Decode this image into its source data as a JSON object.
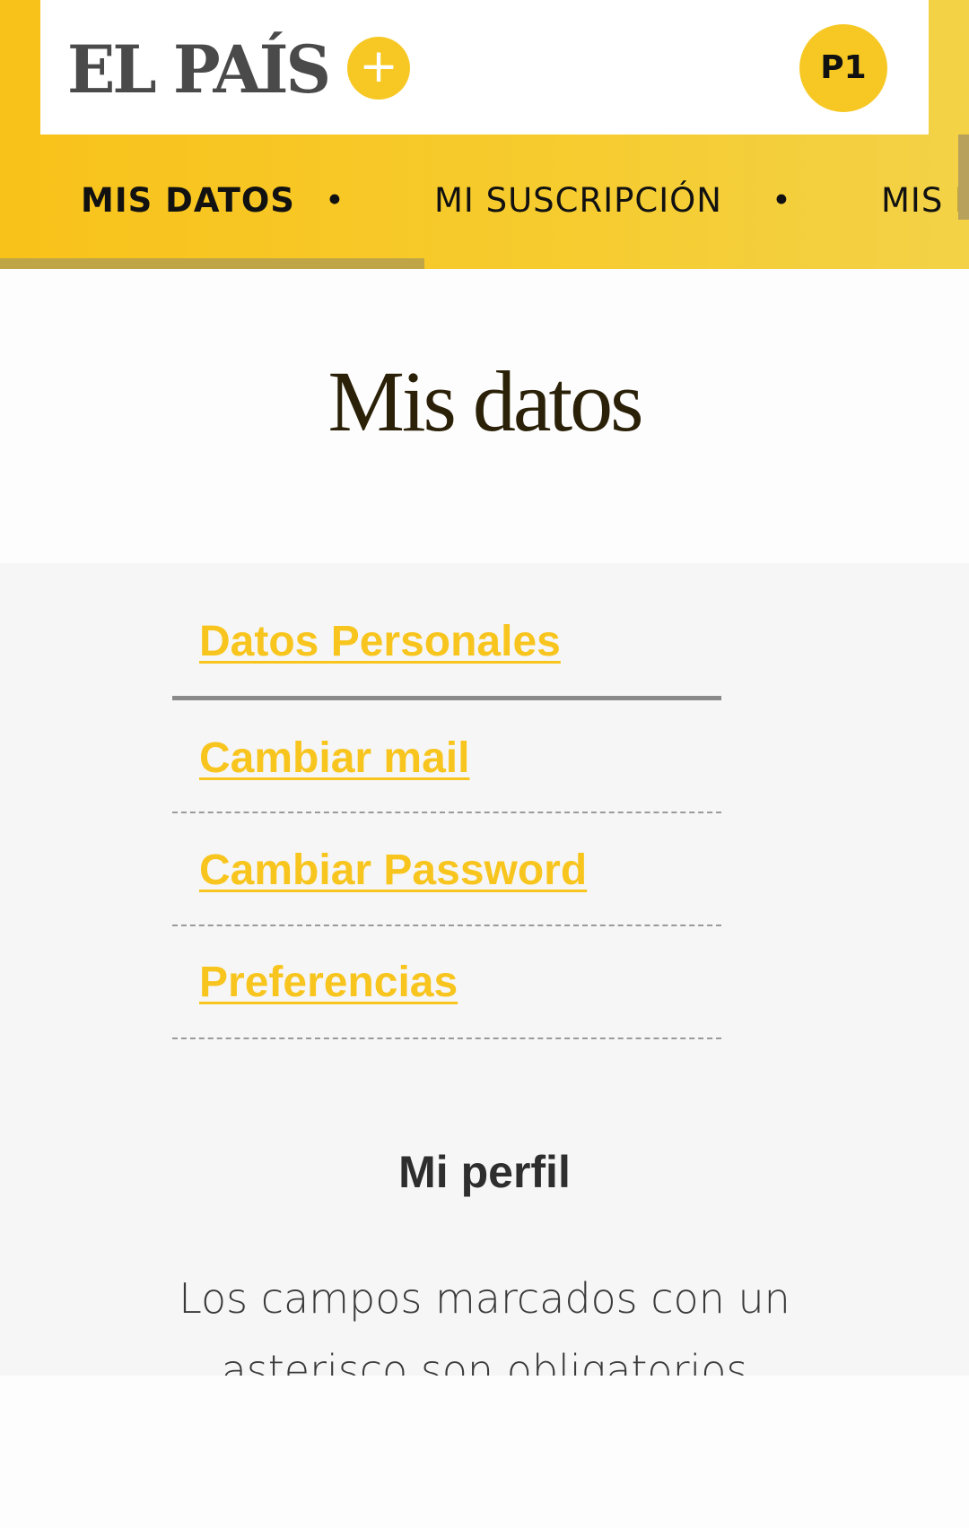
{
  "header": {
    "logo_text": "EL PAÍS",
    "logo_plus": "+",
    "avatar_initials": "P1"
  },
  "nav": {
    "items": [
      {
        "label": "MIS DATOS",
        "active": true
      },
      {
        "label": "MI SUSCRIPCIÓN",
        "active": false
      },
      {
        "label": "MIS N",
        "active": false
      }
    ],
    "separator": "•"
  },
  "page": {
    "title": "Mis datos"
  },
  "menu": {
    "items": [
      {
        "label": "Datos Personales"
      },
      {
        "label": "Cambiar mail"
      },
      {
        "label": "Cambiar Password"
      },
      {
        "label": "Preferencias"
      }
    ]
  },
  "profile": {
    "title": "Mi perfil",
    "description": "Los campos marcados con un asterisco son obligatorios"
  },
  "colors": {
    "brand_yellow": "#f7c824",
    "link_yellow": "#f8c51f",
    "panel_gray": "#f6f6f6",
    "title_brown": "#2b2108"
  },
  "icons": {
    "logo_plus": "plus-icon"
  }
}
